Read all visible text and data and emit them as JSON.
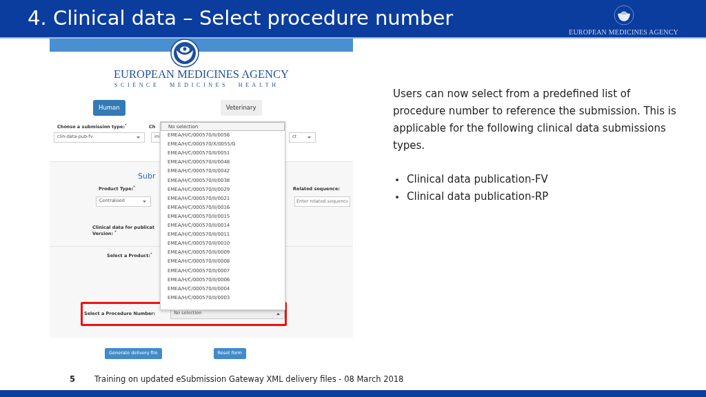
{
  "slide": {
    "title": "4. Clinical data – Select procedure number",
    "logo_text": "EUROPEAN MEDICINES AGENCY",
    "body": "Users can now select from a predefined list of procedure number to reference the submission. This is applicable for the following clinical data submissions types.",
    "bullets": [
      "Clinical data publication-FV",
      "Clinical data publication-RP"
    ],
    "page_number": "5",
    "footer": "Training on updated eSubmission Gateway XML delivery files - 08 March 2018"
  },
  "app": {
    "brand": "EUROPEAN MEDICINES AGENCY",
    "tagline": "SCIENCE MEDICINES HEALTH",
    "tabs": [
      {
        "label": "Human",
        "selected": true
      },
      {
        "label": "Veterinary",
        "selected": false
      }
    ],
    "submission_type": {
      "label": "Choose a submission type:$^{*}$",
      "value": "clin-data-pub-fv"
    },
    "column_2": {
      "label": "Ch",
      "value": "ini"
    },
    "column_3": {
      "value": "ct"
    },
    "section_heading": "Subr",
    "product_type": {
      "label": "Product Type:$^{*}$",
      "value": "Centralised"
    },
    "related_sequence": {
      "label": "Related sequence:",
      "placeholder": "Enter related sequence"
    },
    "version": {
      "label": "Clinical data for publicat",
      "label_line_2": "Version: $^{*}$"
    },
    "product": {
      "label": "Select a Product:$^{*}$"
    },
    "procedure_number": {
      "label": "Select a Procedure Number:",
      "value": "No selection",
      "expanded": true,
      "highlighted": true,
      "options": [
        {
          "label": "No selection",
          "selected": true
        },
        {
          "label": "EMEA/H/C/000570/II/0056",
          "selected": false
        },
        {
          "label": "EMEA/H/C/000570/X/0055/G",
          "selected": false
        },
        {
          "label": "EMEA/H/C/000570/II/0051",
          "selected": false
        },
        {
          "label": "EMEA/H/C/000570/II/0048",
          "selected": false
        },
        {
          "label": "EMEA/H/C/000570/II/0042",
          "selected": false
        },
        {
          "label": "EMEA/H/C/000570/II/0038",
          "selected": false
        },
        {
          "label": "EMEA/H/C/000570/II/0029",
          "selected": false
        },
        {
          "label": "EMEA/H/C/000570/II/0021",
          "selected": false
        },
        {
          "label": "EMEA/H/C/000570/II/0016",
          "selected": false
        },
        {
          "label": "EMEA/H/C/000570/II/0015",
          "selected": false
        },
        {
          "label": "EMEA/H/C/000570/II/0014",
          "selected": false
        },
        {
          "label": "EMEA/H/C/000570/II/0011",
          "selected": false
        },
        {
          "label": "EMEA/H/C/000570/II/0010",
          "selected": false
        },
        {
          "label": "EMEA/H/C/000570/II/0009",
          "selected": false
        },
        {
          "label": "EMEA/H/C/000570/II/0008",
          "selected": false
        },
        {
          "label": "EMEA/H/C/000570/II/0007",
          "selected": false
        },
        {
          "label": "EMEA/H/C/000570/II/0006",
          "selected": false
        },
        {
          "label": "EMEA/H/C/000570/II/0004",
          "selected": false
        },
        {
          "label": "EMEA/H/C/000570/II/0003",
          "selected": false
        }
      ]
    },
    "buttons": [
      "Generate delivery file",
      "Reset form"
    ]
  }
}
